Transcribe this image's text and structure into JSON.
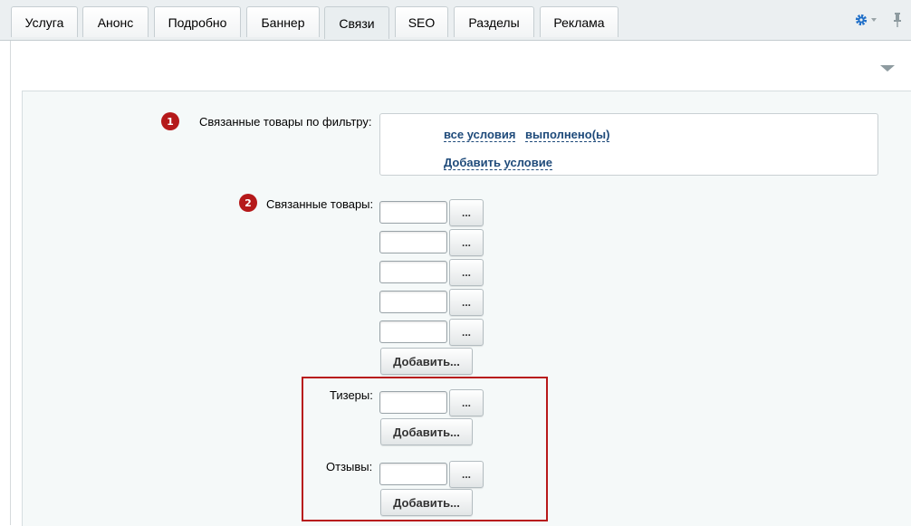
{
  "tabs": [
    {
      "label": "Услуга",
      "active": false
    },
    {
      "label": "Анонс",
      "active": false
    },
    {
      "label": "Подробно",
      "active": false
    },
    {
      "label": "Баннер",
      "active": false
    },
    {
      "label": "Связи",
      "active": true
    },
    {
      "label": "SEO",
      "active": false
    },
    {
      "label": "Разделы",
      "active": false
    },
    {
      "label": "Реклама",
      "active": false
    }
  ],
  "toolbar": {
    "settings_icon": "gear-icon",
    "pin_icon": "pin-icon",
    "accent_color": "#1e6ec8"
  },
  "form": {
    "filter": {
      "badge": "1",
      "label": "Связанные товары по фильтру:",
      "all_conditions": "все условия",
      "fulfilled": "выполнено(ы)",
      "add_condition": "Добавить условие"
    },
    "related": {
      "badge": "2",
      "label": "Связанные товары:",
      "inputs": [
        "",
        "",
        "",
        "",
        ""
      ],
      "pick_label": "...",
      "add_label": "Добавить..."
    },
    "teasers": {
      "label": "Тизеры:",
      "input": "",
      "pick_label": "...",
      "add_label": "Добавить..."
    },
    "reviews": {
      "label": "Отзывы:",
      "input": "",
      "pick_label": "...",
      "add_label": "Добавить..."
    }
  },
  "colors": {
    "badge": "#b5191a",
    "highlight_border": "#b8191a",
    "link": "#1e4a7a"
  }
}
